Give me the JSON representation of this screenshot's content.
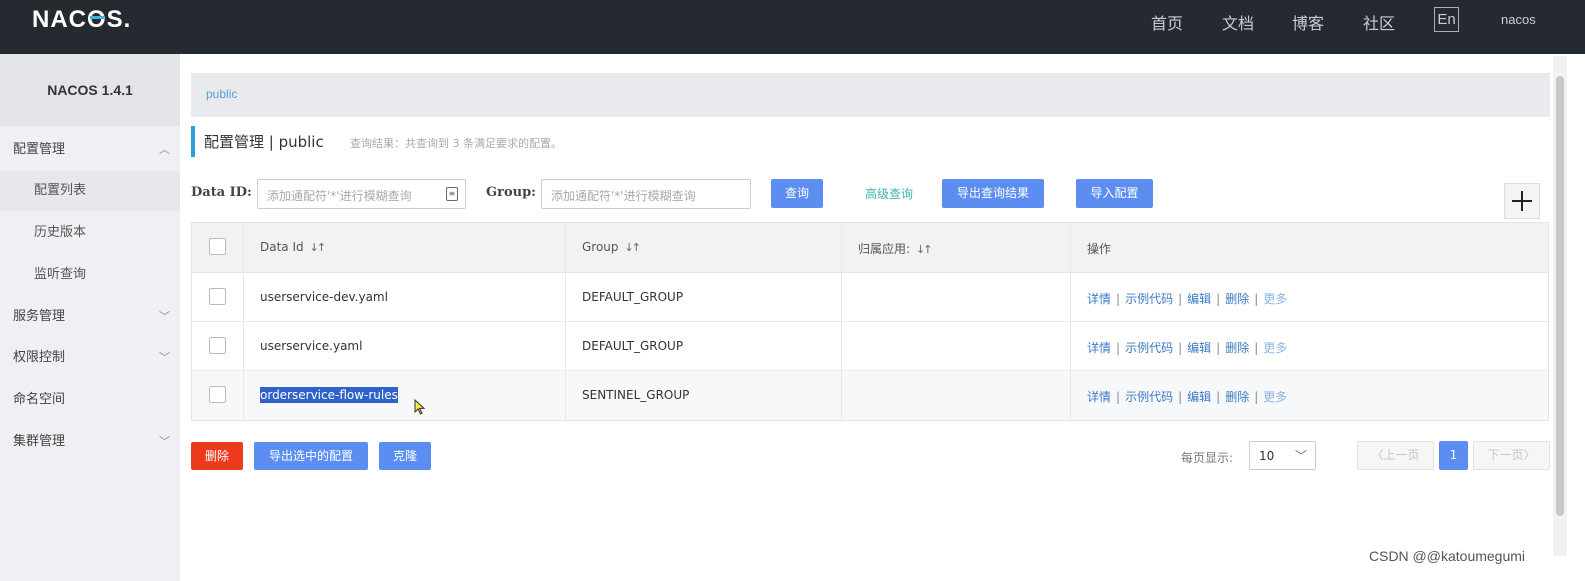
{
  "header": {
    "logo": "NACOS.",
    "nav": [
      "首页",
      "文档",
      "博客",
      "社区"
    ],
    "lang": "En",
    "user": "nacos"
  },
  "sidebar": {
    "brand": "NACOS 1.4.1",
    "items": [
      {
        "label": "配置管理",
        "level": 1,
        "chevron": "︿"
      },
      {
        "label": "配置列表",
        "level": 2
      },
      {
        "label": "历史版本",
        "level": 2
      },
      {
        "label": "监听查询",
        "level": 2
      },
      {
        "label": "服务管理",
        "level": 1,
        "chevron": "﹀"
      },
      {
        "label": "权限控制",
        "level": 1,
        "chevron": "﹀"
      },
      {
        "label": "命名空间",
        "level": 1
      },
      {
        "label": "集群管理",
        "level": 1,
        "chevron": "﹀"
      }
    ]
  },
  "breadcrumb": "public",
  "page": {
    "title": "配置管理 | public",
    "result": "查询结果：共查询到 3 条满足要求的配置。"
  },
  "search": {
    "dataid_label": "Data ID:",
    "dataid_placeholder": "添加通配符'*'进行模糊查询",
    "group_label": "Group:",
    "group_placeholder": "添加通配符'*'进行模糊查询",
    "query_btn": "查询",
    "advanced": "高级查询",
    "export_btn": "导出查询结果",
    "import_btn": "导入配置",
    "add_btn": "+"
  },
  "table": {
    "headers": [
      "Data Id",
      "Group",
      "归属应用:",
      "操作"
    ],
    "rows": [
      {
        "data_id": "userservice-dev.yaml",
        "group": "DEFAULT_GROUP",
        "app": ""
      },
      {
        "data_id": "userservice.yaml",
        "group": "DEFAULT_GROUP",
        "app": ""
      },
      {
        "data_id": "orderservice-flow-rules",
        "group": "SENTINEL_GROUP",
        "app": ""
      }
    ],
    "ops": {
      "detail": "详情",
      "sample": "示例代码",
      "edit": "编辑",
      "delete": "删除",
      "more": "更多",
      "sep": "|"
    }
  },
  "footer": {
    "delete_btn": "删除",
    "export_selected_btn": "导出选中的配置",
    "clone_btn": "克隆",
    "page_size_label": "每页显示:",
    "page_size": "10",
    "prev": "上一页",
    "current_page": "1",
    "next": "下一页"
  },
  "watermark": "CSDN @@katoumegumi",
  "colors": {
    "topbar": "#252a30",
    "primary": "#5b8ef0",
    "danger": "#ee3a1c",
    "accent": "#2aa0d8"
  }
}
